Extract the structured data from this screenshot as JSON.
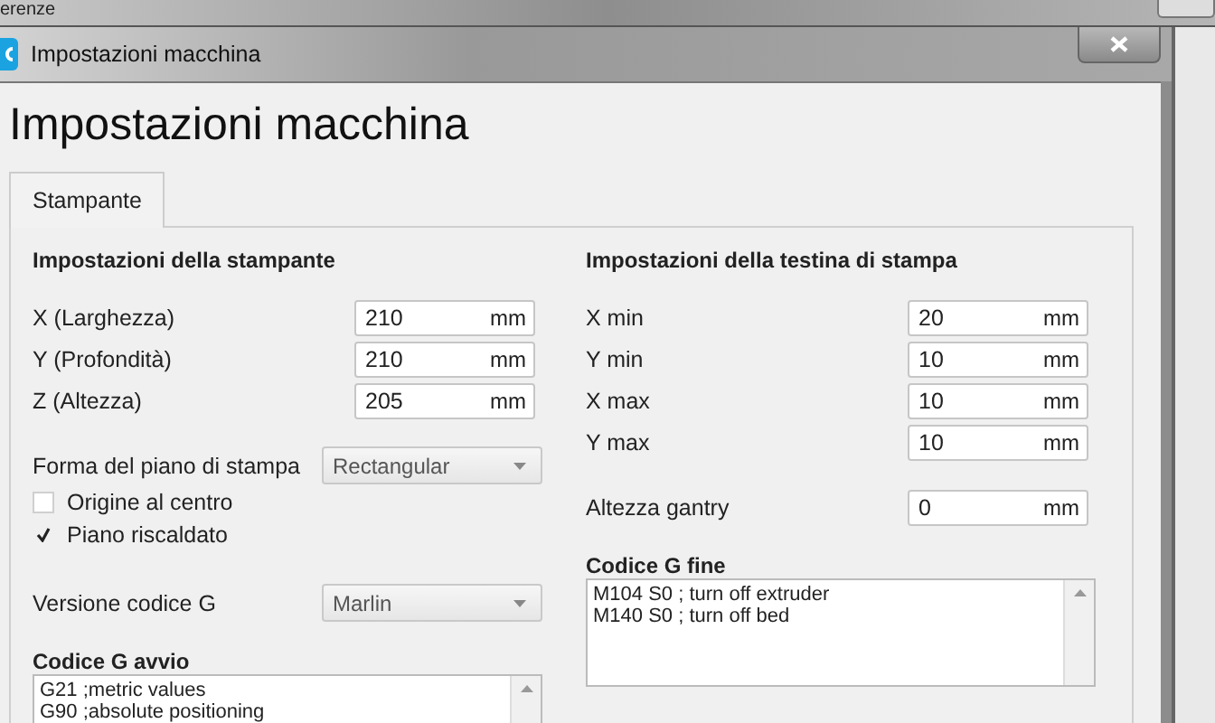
{
  "background_window": {
    "title_fragment": "erenze"
  },
  "dialog": {
    "title": "Impostazioni macchina",
    "heading": "Impostazioni macchina",
    "tabs": [
      {
        "label": "Stampante",
        "selected": true
      }
    ],
    "printer_settings": {
      "title": "Impostazioni della stampante",
      "fields": [
        {
          "label": "X (Larghezza)",
          "value": "210",
          "unit": "mm"
        },
        {
          "label": "Y (Profondità)",
          "value": "210",
          "unit": "mm"
        },
        {
          "label": "Z (Altezza)",
          "value": "205",
          "unit": "mm"
        }
      ],
      "bed_shape": {
        "label": "Forma del piano di stampa",
        "value": "Rectangular"
      },
      "checkboxes": [
        {
          "label": "Origine al centro",
          "checked": false
        },
        {
          "label": "Piano riscaldato",
          "checked": true
        }
      ],
      "gcode_flavor": {
        "label": "Versione codice G",
        "value": "Marlin"
      }
    },
    "head_settings": {
      "title": "Impostazioni della testina di stampa",
      "fields": [
        {
          "label": "X min",
          "value": "20",
          "unit": "mm"
        },
        {
          "label": "Y min",
          "value": "10",
          "unit": "mm"
        },
        {
          "label": "X max",
          "value": "10",
          "unit": "mm"
        },
        {
          "label": "Y max",
          "value": "10",
          "unit": "mm"
        }
      ],
      "gantry": {
        "label": "Altezza gantry",
        "value": "0",
        "unit": "mm"
      }
    },
    "start_gcode": {
      "title": "Codice G avvio",
      "lines": [
        "G21 ;metric values",
        "G90 ;absolute positioning"
      ]
    },
    "end_gcode": {
      "title": "Codice G fine",
      "lines": [
        "M104 S0 ; turn off extruder",
        "M140 S0 ; turn off bed"
      ]
    }
  }
}
